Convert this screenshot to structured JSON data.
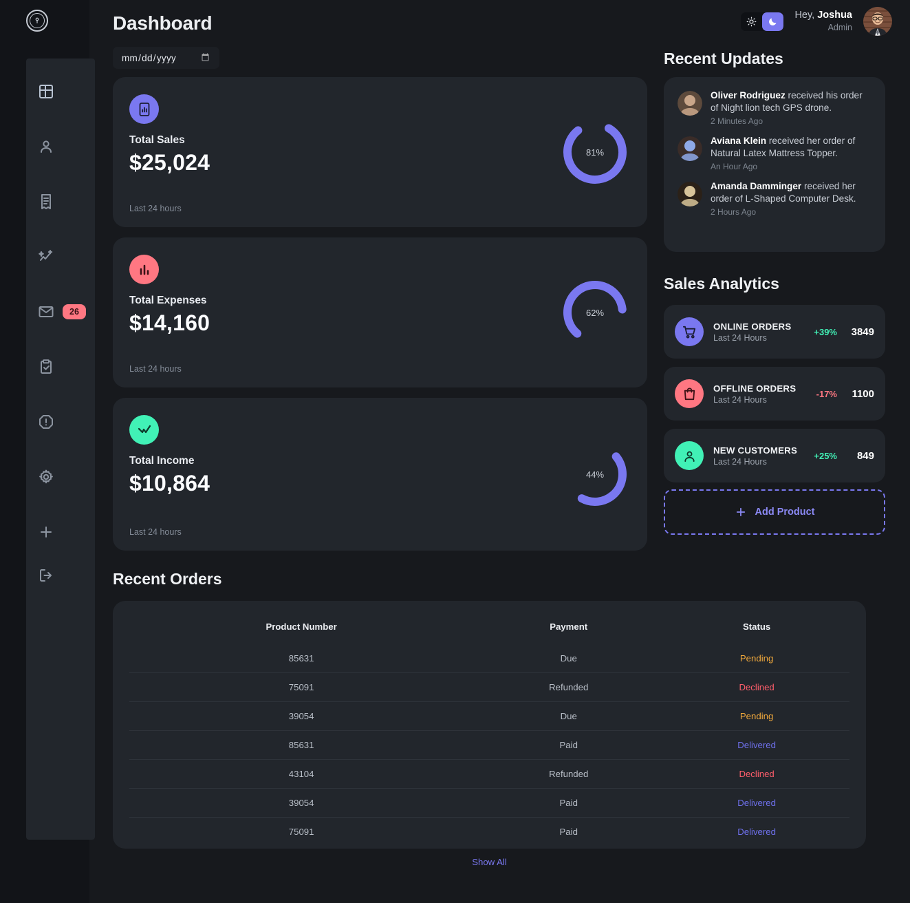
{
  "colors": {
    "accent": "#7a78f0",
    "danger": "#ff7782",
    "success": "#41f1b6",
    "warning": "#f0a83c",
    "page_bg": "#17191d",
    "card_bg": "#22262c"
  },
  "sidebar": {
    "logo_icon": "shield-lock-icon",
    "items": [
      {
        "icon": "dashboard-grid-icon",
        "name": "dashboard",
        "active": true
      },
      {
        "icon": "user-icon",
        "name": "customers",
        "active": false
      },
      {
        "icon": "receipt-icon",
        "name": "orders",
        "active": false
      },
      {
        "icon": "analytics-sparkle-icon",
        "name": "analytics",
        "active": false
      },
      {
        "icon": "mail-icon",
        "name": "messages",
        "active": false,
        "badge": "26"
      },
      {
        "icon": "clipboard-check-icon",
        "name": "products",
        "active": false
      },
      {
        "icon": "alert-octagon-icon",
        "name": "reports",
        "active": false
      },
      {
        "icon": "gear-icon",
        "name": "settings",
        "active": false
      },
      {
        "icon": "plus-icon",
        "name": "add-product",
        "active": false
      },
      {
        "icon": "logout-icon",
        "name": "logout",
        "active": false
      }
    ]
  },
  "header": {
    "title": "Dashboard",
    "date_placeholder": "mm/dd/yyyy",
    "date_value": "",
    "theme": {
      "light_icon": "sun-icon",
      "dark_icon": "moon-icon",
      "active": "dark"
    },
    "greeting_prefix": "Hey, ",
    "user_name": "Joshua",
    "user_role": "Admin"
  },
  "insights": [
    {
      "title": "Total Sales",
      "value": "$25,024",
      "subtitle": "Last 24 hours",
      "percent": 81,
      "percent_label": "81%",
      "icon": "bar-chart-box-icon",
      "icon_bg": "#7a78f0",
      "icon_color": "#1b1d34"
    },
    {
      "title": "Total Expenses",
      "value": "$14,160",
      "subtitle": "Last 24 hours",
      "percent": 62,
      "percent_label": "62%",
      "icon": "bar-chart-icon",
      "icon_bg": "#ff7782",
      "icon_color": "#3a1216"
    },
    {
      "title": "Total Income",
      "value": "$10,864",
      "subtitle": "Last 24 hours",
      "percent": 44,
      "percent_label": "44%",
      "icon": "line-chart-icon",
      "icon_bg": "#41f1b6",
      "icon_color": "#0d3b2c"
    }
  ],
  "recent_updates": {
    "title": "Recent Updates",
    "items": [
      {
        "name": "Oliver Rodriguez",
        "message": " received his order of Night lion tech GPS drone.",
        "time": "2 Minutes Ago",
        "avatar_colors": [
          "#c9a68a",
          "#5d4a3c"
        ]
      },
      {
        "name": "Aviana Klein",
        "message": " received her order of Natural Latex Mattress Topper.",
        "time": "An Hour Ago",
        "avatar_colors": [
          "#8fa9e8",
          "#3a2c28"
        ]
      },
      {
        "name": "Amanda Damminger",
        "message": " received her order of L-Shaped Computer Desk.",
        "time": "2 Hours Ago",
        "avatar_colors": [
          "#d8c49a",
          "#2b2118"
        ]
      }
    ]
  },
  "sales_analytics": {
    "title": "Sales Analytics",
    "items": [
      {
        "name": "ONLINE ORDERS",
        "subtitle": "Last 24 Hours",
        "percent": "+39%",
        "percent_dir": "up",
        "value": "3849",
        "icon": "shopping-cart-icon",
        "icon_bg": "#7a78f0",
        "icon_color": "#1b1d34"
      },
      {
        "name": "OFFLINE ORDERS",
        "subtitle": "Last 24 Hours",
        "percent": "-17%",
        "percent_dir": "down",
        "value": "1100",
        "icon": "shopping-bag-icon",
        "icon_bg": "#ff7782",
        "icon_color": "#3a1216"
      },
      {
        "name": "NEW CUSTOMERS",
        "subtitle": "Last 24 Hours",
        "percent": "+25%",
        "percent_dir": "up",
        "value": "849",
        "icon": "user-icon",
        "icon_bg": "#41f1b6",
        "icon_color": "#0d3b2c"
      }
    ],
    "add_product_label": "Add Product",
    "add_product_icon": "plus-icon"
  },
  "recent_orders": {
    "title": "Recent Orders",
    "columns": [
      "Product Number",
      "Payment",
      "Status"
    ],
    "rows": [
      {
        "product_number": "85631",
        "payment": "Due",
        "status": "Pending",
        "status_kind": "pending"
      },
      {
        "product_number": "75091",
        "payment": "Refunded",
        "status": "Declined",
        "status_kind": "declined"
      },
      {
        "product_number": "39054",
        "payment": "Due",
        "status": "Pending",
        "status_kind": "pending"
      },
      {
        "product_number": "85631",
        "payment": "Paid",
        "status": "Delivered",
        "status_kind": "delivered"
      },
      {
        "product_number": "43104",
        "payment": "Refunded",
        "status": "Declined",
        "status_kind": "declined"
      },
      {
        "product_number": "39054",
        "payment": "Paid",
        "status": "Delivered",
        "status_kind": "delivered"
      },
      {
        "product_number": "75091",
        "payment": "Paid",
        "status": "Delivered",
        "status_kind": "delivered"
      }
    ],
    "show_all_label": "Show All"
  }
}
